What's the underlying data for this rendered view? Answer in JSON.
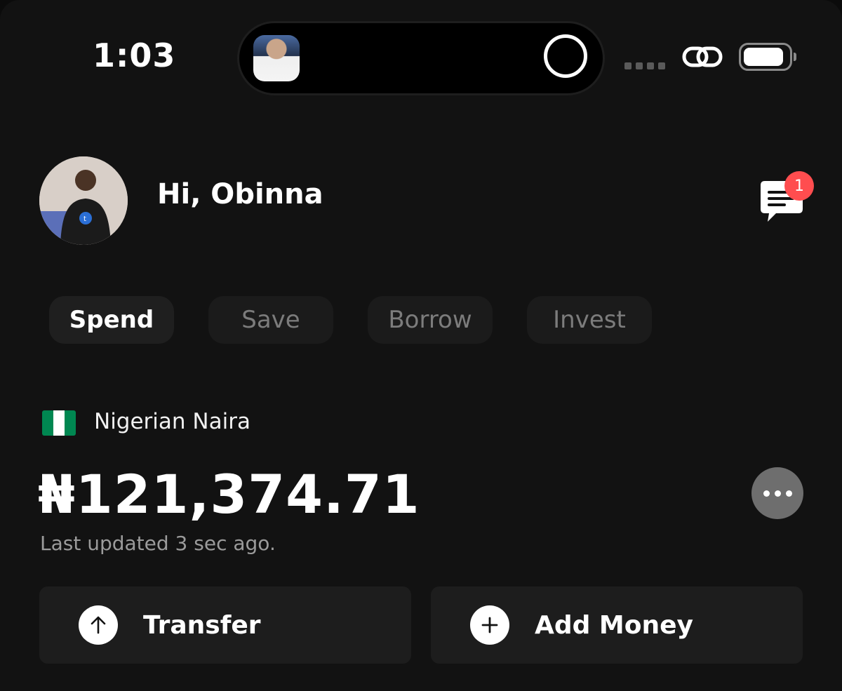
{
  "status_bar": {
    "time": "1:03"
  },
  "header": {
    "greeting": "Hi, Obinna",
    "notification_count": "1",
    "notification_badge_color": "#ff4d4f"
  },
  "tabs": [
    {
      "label": "Spend",
      "active": true
    },
    {
      "label": "Save",
      "active": false
    },
    {
      "label": "Borrow",
      "active": false
    },
    {
      "label": "Invest",
      "active": false
    }
  ],
  "wallet": {
    "currency_name": "Nigerian Naira",
    "flag_colors": [
      "#008751",
      "#ffffff",
      "#008751"
    ],
    "balance": "₦121,374.71",
    "last_updated": "Last updated 3 sec ago."
  },
  "actions": [
    {
      "label": "Transfer",
      "icon": "arrow-up-icon"
    },
    {
      "label": "Add Money",
      "icon": "plus-icon"
    }
  ],
  "theme": {
    "background": "#121212",
    "surface": "#1d1d1d",
    "text_primary": "#ffffff",
    "text_muted": "#9b9b9b"
  }
}
